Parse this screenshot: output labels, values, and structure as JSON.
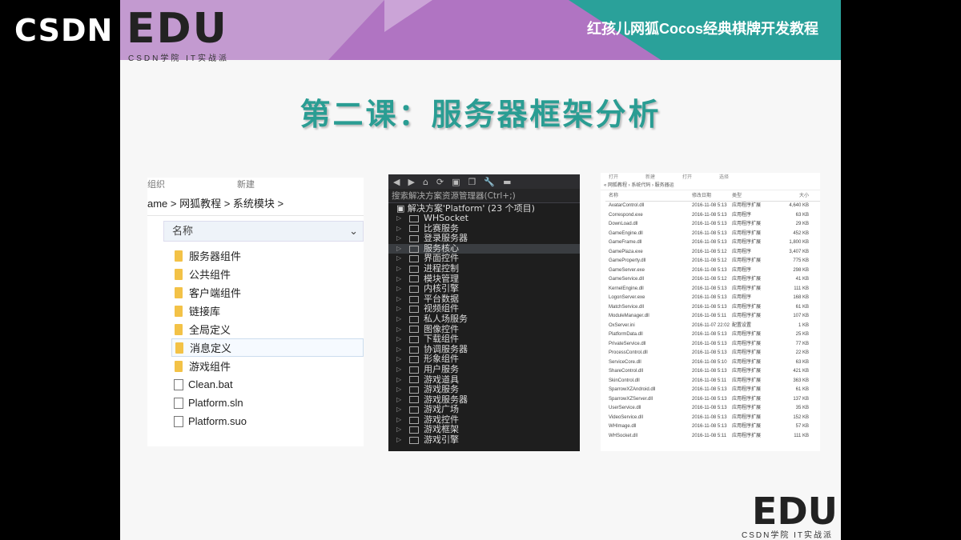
{
  "header": {
    "csdn": "CSDN",
    "edu": "EDU",
    "edu_sub": "CSDN学院 IT实战派",
    "course_title": "红孩儿网狐Cocos经典棋牌开发教程"
  },
  "lesson_title": "第二课：服务器框架分析",
  "explorer": {
    "tabs": [
      "组织",
      "新建"
    ],
    "breadcrumb": "ame  >  网狐教程  >  系统模块  >",
    "column_name": "名称",
    "items": [
      {
        "name": "服务器组件",
        "type": "folder"
      },
      {
        "name": "公共组件",
        "type": "folder"
      },
      {
        "name": "客户端组件",
        "type": "folder"
      },
      {
        "name": "链接库",
        "type": "folder"
      },
      {
        "name": "全局定义",
        "type": "folder"
      },
      {
        "name": "消息定义",
        "type": "folder"
      },
      {
        "name": "游戏组件",
        "type": "folder"
      },
      {
        "name": "Clean.bat",
        "type": "file"
      },
      {
        "name": "Platform.sln",
        "type": "file"
      },
      {
        "name": "Platform.suo",
        "type": "file"
      }
    ]
  },
  "solution": {
    "search": "搜索解决方案资源管理器(Ctrl+;)",
    "title": "解决方案'Platform' (23 个项目)",
    "projects": [
      "WHSocket",
      "比赛服务",
      "登录服务器",
      "服务核心",
      "界面控件",
      "进程控制",
      "模块管理",
      "内核引擎",
      "平台数据",
      "视频组件",
      "私人场服务",
      "图像控件",
      "下载组件",
      "协调服务器",
      "形象组件",
      "用户服务",
      "游戏道具",
      "游戏服务",
      "游戏服务器",
      "游戏广场",
      "游戏控件",
      "游戏框架",
      "游戏引擎"
    ],
    "selected_index": 3
  },
  "filelist": {
    "tabs": [
      "打开",
      "新建",
      "打开",
      "选择"
    ],
    "breadcrumb": "« 网狐教程 › 系统代码 › 服务器运",
    "headers": [
      "名称",
      "修改日期",
      "类型",
      "大小"
    ],
    "rows": [
      [
        "AvatarControl.dll",
        "2016-11-08 5:13",
        "应用程序扩展",
        "4,640 KB"
      ],
      [
        "Correspond.exe",
        "2016-11-08 5:13",
        "应用程序",
        "63 KB"
      ],
      [
        "DownLoad.dll",
        "2016-11-08 5:13",
        "应用程序扩展",
        "29 KB"
      ],
      [
        "GameEngine.dll",
        "2016-11-08 5:13",
        "应用程序扩展",
        "452 KB"
      ],
      [
        "GameFrame.dll",
        "2016-11-08 5:13",
        "应用程序扩展",
        "1,800 KB"
      ],
      [
        "GamePlaza.exe",
        "2016-11-08 5:12",
        "应用程序",
        "3,407 KB"
      ],
      [
        "GameProperty.dll",
        "2016-11-08 5:12",
        "应用程序扩展",
        "775 KB"
      ],
      [
        "GameServer.exe",
        "2016-11-08 5:13",
        "应用程序",
        "298 KB"
      ],
      [
        "GameService.dll",
        "2016-11-08 5:12",
        "应用程序扩展",
        "41 KB"
      ],
      [
        "KernelEngine.dll",
        "2016-11-08 5:13",
        "应用程序扩展",
        "111 KB"
      ],
      [
        "LogonServer.exe",
        "2016-11-08 5:13",
        "应用程序",
        "168 KB"
      ],
      [
        "MatchService.dll",
        "2016-11-08 5:13",
        "应用程序扩展",
        "61 KB"
      ],
      [
        "ModuleManager.dll",
        "2016-11-08 5:11",
        "应用程序扩展",
        "107 KB"
      ],
      [
        "OxServer.ini",
        "2016-11-07 22:02",
        "配置设置",
        "1 KB"
      ],
      [
        "PlatformData.dll",
        "2016-11-08 5:13",
        "应用程序扩展",
        "25 KB"
      ],
      [
        "PrivateService.dll",
        "2016-11-08 5:13",
        "应用程序扩展",
        "77 KB"
      ],
      [
        "ProcessControl.dll",
        "2016-11-08 5:13",
        "应用程序扩展",
        "22 KB"
      ],
      [
        "ServiceCore.dll",
        "2016-11-08 5:10",
        "应用程序扩展",
        "63 KB"
      ],
      [
        "ShareControl.dll",
        "2016-11-08 5:13",
        "应用程序扩展",
        "421 KB"
      ],
      [
        "SkinControl.dll",
        "2016-11-08 5:11",
        "应用程序扩展",
        "363 KB"
      ],
      [
        "SparrowXZAndroid.dll",
        "2016-11-08 5:13",
        "应用程序扩展",
        "61 KB"
      ],
      [
        "SparrowXZServer.dll",
        "2016-11-08 5:13",
        "应用程序扩展",
        "137 KB"
      ],
      [
        "UserService.dll",
        "2016-11-08 5:13",
        "应用程序扩展",
        "35 KB"
      ],
      [
        "VideoService.dll",
        "2016-11-08 5:13",
        "应用程序扩展",
        "152 KB"
      ],
      [
        "WHImage.dll",
        "2016-11-08 5:13",
        "应用程序扩展",
        "57 KB"
      ],
      [
        "WHSocket.dll",
        "2016-11-08 5:11",
        "应用程序扩展",
        "111 KB"
      ]
    ]
  },
  "footer": {
    "edu": "EDU",
    "edu_sub": "CSDN学院 IT实战派"
  }
}
